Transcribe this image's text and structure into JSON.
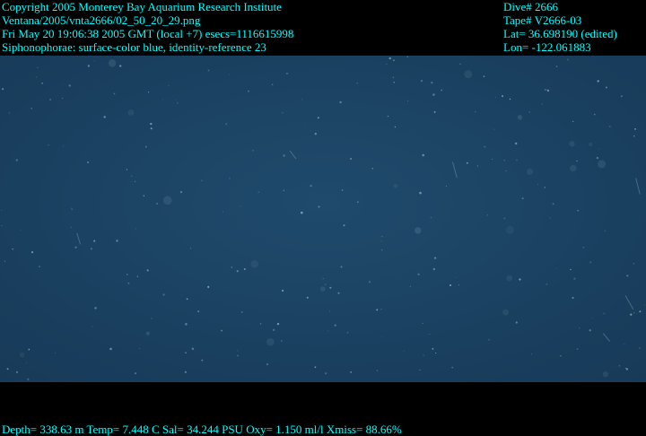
{
  "overlay_top_left": {
    "line1": "Copyright 2005 Monterey Bay Aquarium Research Institute",
    "line2": "Ventana/2005/vnta2666/02_50_20_29.png",
    "line3": "Fri May 20 19:06:38 2005 GMT (local +7)  esecs=1116615998",
    "line4": "Siphonophorae: surface-color blue, identity-reference 23"
  },
  "overlay_top_right": {
    "dive": "Dive# 2666",
    "tape": "Tape# V2666-03",
    "lat": "Lat= 36.698190 (edited)",
    "lon": "Lon= -122.061883"
  },
  "overlay_bottom": {
    "telemetry": "Depth= 338.63 m  Temp= 7.448 C  Sal= 34.244 PSU  Oxy= 1.150 ml/l  Xmiss= 88.66%"
  },
  "colors": {
    "overlay_text": "#00ffff",
    "background": "#000000",
    "water_center": "#1f4a6c",
    "water_edge": "#173a58",
    "particles": "#9fb8c8"
  }
}
